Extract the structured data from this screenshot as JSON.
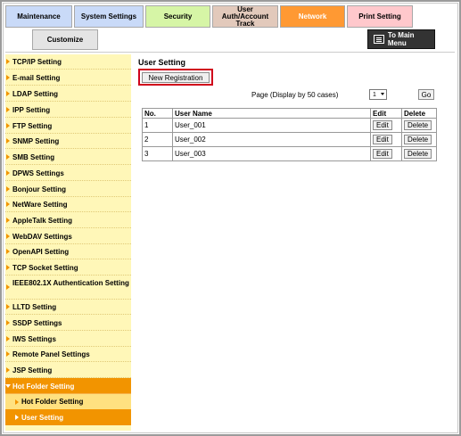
{
  "tabs": {
    "maintenance": "Maintenance",
    "system_settings": "System Settings",
    "security": "Security",
    "user_auth": "User Auth/Account Track",
    "network": "Network",
    "print_setting": "Print Setting",
    "customize": "Customize"
  },
  "to_main_menu": "To Main Menu",
  "sidebar": {
    "items": [
      "TCP/IP Setting",
      "E-mail Setting",
      "LDAP Setting",
      "IPP Setting",
      "FTP Setting",
      "SNMP Setting",
      "SMB Setting",
      "DPWS Settings",
      "Bonjour Setting",
      "NetWare Setting",
      "AppleTalk Setting",
      "WebDAV Settings",
      "OpenAPI Setting",
      "TCP Socket Setting",
      "IEEE802.1X Authentication Setting",
      "LLTD Setting",
      "SSDP Settings",
      "IWS Settings",
      "Remote Panel Settings",
      "JSP Setting",
      "Hot Folder Setting"
    ],
    "sub_items": [
      "Hot Folder Setting",
      "User Setting"
    ]
  },
  "content": {
    "title": "User Setting",
    "new_registration": "New Registration",
    "page_label": "Page (Display by 50 cases)",
    "page_value": "1",
    "go": "Go",
    "table": {
      "headers": [
        "No.",
        "User Name",
        "Edit",
        "Delete"
      ],
      "rows": [
        {
          "no": "1",
          "name": "User_001",
          "edit": "Edit",
          "delete": "Delete"
        },
        {
          "no": "2",
          "name": "User_002",
          "edit": "Edit",
          "delete": "Delete"
        },
        {
          "no": "3",
          "name": "User_003",
          "edit": "Edit",
          "delete": "Delete"
        }
      ]
    }
  },
  "colors": {
    "network_tab": "#ff9933",
    "sidebar_bg": "#fff7b8",
    "active_item": "#f29400",
    "highlight_border": "#d0021b"
  }
}
